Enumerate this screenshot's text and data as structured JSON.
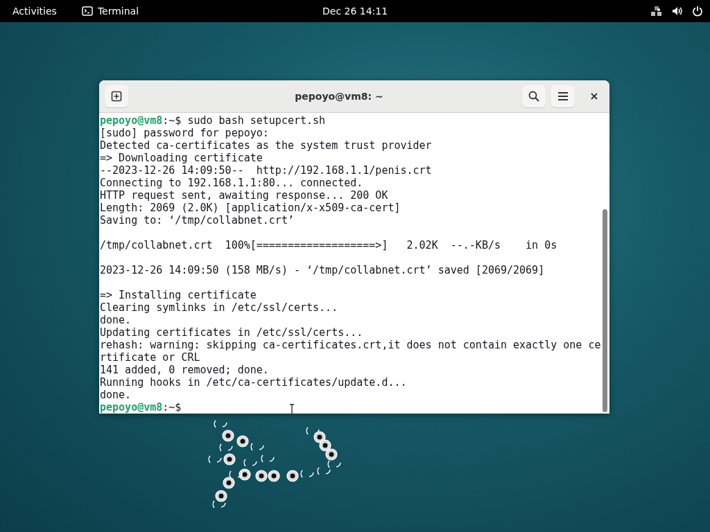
{
  "top_bar": {
    "activities": "Activities",
    "app_name": "Terminal",
    "clock": "Dec 26  14:11"
  },
  "window": {
    "title": "pepoyo@vm8: ~"
  },
  "terminal": {
    "lines": [
      {
        "kind": "prompt",
        "host": "pepoyo@vm8",
        "cwd": ":~$",
        "command": "sudo bash setupcert.sh"
      },
      {
        "kind": "output",
        "text": "[sudo] password for pepoyo:"
      },
      {
        "kind": "output",
        "text": "Detected ca-certificates as the system trust provider"
      },
      {
        "kind": "output",
        "text": "=> Downloading certificate"
      },
      {
        "kind": "output",
        "text": "--2023-12-26 14:09:50--  http://192.168.1.1/penis.crt"
      },
      {
        "kind": "output",
        "text": "Connecting to 192.168.1.1:80... connected."
      },
      {
        "kind": "output",
        "text": "HTTP request sent, awaiting response... 200 OK"
      },
      {
        "kind": "output",
        "text": "Length: 2069 (2.0K) [application/x-x509-ca-cert]"
      },
      {
        "kind": "output",
        "text": "Saving to: ‘/tmp/collabnet.crt’"
      },
      {
        "kind": "blank"
      },
      {
        "kind": "output",
        "text": "/tmp/collabnet.crt  100%[===================>]   2.02K  --.-KB/s    in 0s"
      },
      {
        "kind": "blank"
      },
      {
        "kind": "output",
        "text": "2023-12-26 14:09:50 (158 MB/s) - ‘/tmp/collabnet.crt’ saved [2069/2069]"
      },
      {
        "kind": "blank"
      },
      {
        "kind": "output",
        "text": "=> Installing certificate"
      },
      {
        "kind": "output",
        "text": "Clearing symlinks in /etc/ssl/certs..."
      },
      {
        "kind": "output",
        "text": "done."
      },
      {
        "kind": "output",
        "text": "Updating certificates in /etc/ssl/certs..."
      },
      {
        "kind": "output",
        "text": "rehash: warning: skipping ca-certificates.crt,it does not contain exactly one ce"
      },
      {
        "kind": "output",
        "text": "rtificate or CRL"
      },
      {
        "kind": "output",
        "text": "141 added, 0 removed; done."
      },
      {
        "kind": "output",
        "text": "Running hooks in /etc/ca-certificates/update.d..."
      },
      {
        "kind": "output",
        "text": "done."
      },
      {
        "kind": "prompt",
        "host": "pepoyo@vm8",
        "cwd": ":~$"
      }
    ]
  }
}
